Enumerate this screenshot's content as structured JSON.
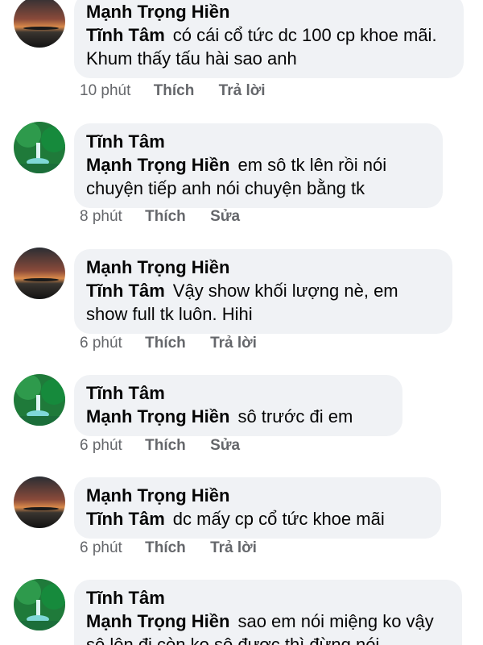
{
  "comments": [
    {
      "author": "Mạnh Trọng Hiền",
      "mention": "Tĩnh Tâm",
      "text": "có cái cổ tức dc 100 cp khoe mãi. Khum thấy tấu hài sao anh",
      "time": "10 phút",
      "like": "Thích",
      "action": "Trả lời",
      "avatar": "sunset-avatar"
    },
    {
      "author": "Tĩnh Tâm",
      "mention": "Mạnh Trọng Hiền",
      "text": "em sô tk lên rồi nói chuyện tiếp anh nói chuyện bằng tk",
      "time": "8 phút",
      "like": "Thích",
      "action": "Sửa",
      "avatar": "waterfall-avatar"
    },
    {
      "author": "Mạnh Trọng Hiền",
      "mention": "Tĩnh Tâm",
      "text": "Vậy show khối lượng nè, em show full tk luôn. Hihi",
      "time": "6 phút",
      "like": "Thích",
      "action": "Trả lời",
      "avatar": "sunset-avatar"
    },
    {
      "author": "Tĩnh Tâm",
      "mention": "Mạnh Trọng Hiền",
      "text": "sô trước đi em",
      "time": "6 phút",
      "like": "Thích",
      "action": "Sửa",
      "avatar": "waterfall-avatar"
    },
    {
      "author": "Mạnh Trọng Hiền",
      "mention": "Tĩnh Tâm",
      "text": "dc mấy cp cổ tức khoe mãi",
      "time": "6 phút",
      "like": "Thích",
      "action": "Trả lời",
      "avatar": "sunset-avatar"
    },
    {
      "author": "Tĩnh Tâm",
      "mention": "Mạnh Trọng Hiền",
      "text": "sao em nói miệng ko vậy sô lên đi còn ko sô được thì đừng nói",
      "avatar": "waterfall-avatar"
    }
  ]
}
